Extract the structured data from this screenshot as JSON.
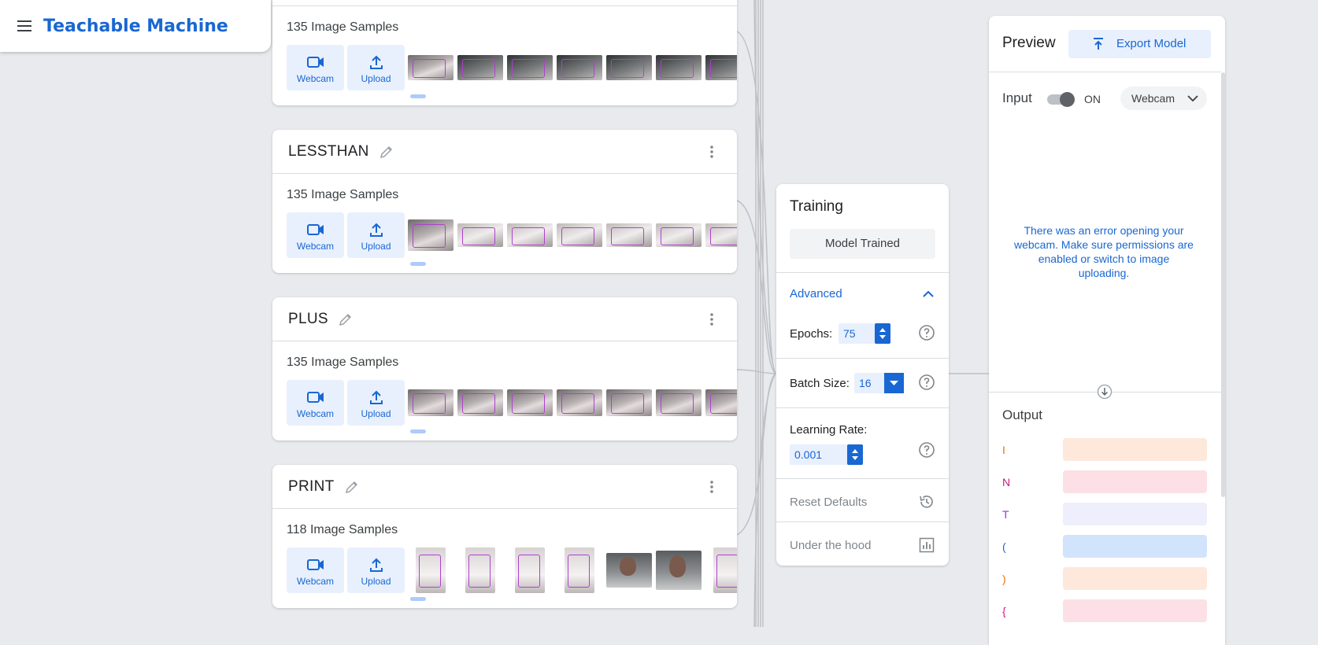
{
  "header": {
    "title": "Teachable Machine"
  },
  "classes": [
    {
      "name": "",
      "sample_count": "135 Image Samples",
      "webcam_label": "Webcam",
      "upload_label": "Upload"
    },
    {
      "name": "LESSTHAN",
      "sample_count": "135 Image Samples",
      "webcam_label": "Webcam",
      "upload_label": "Upload"
    },
    {
      "name": "PLUS",
      "sample_count": "135 Image Samples",
      "webcam_label": "Webcam",
      "upload_label": "Upload"
    },
    {
      "name": "PRINT",
      "sample_count": "118 Image Samples",
      "webcam_label": "Webcam",
      "upload_label": "Upload"
    }
  ],
  "training": {
    "title": "Training",
    "trained_label": "Model Trained",
    "advanced_label": "Advanced",
    "epochs_label": "Epochs:",
    "epochs_value": "75",
    "batch_label": "Batch Size:",
    "batch_value": "16",
    "lr_label": "Learning Rate:",
    "lr_value": "0.001",
    "reset_label": "Reset Defaults",
    "hood_label": "Under the hood"
  },
  "preview": {
    "title": "Preview",
    "export_label": "Export Model",
    "input_label": "Input",
    "toggle_state": "ON",
    "source_label": "Webcam",
    "error_message": "There was an error opening your webcam. Make sure permissions are enabled or switch to image uploading.",
    "output_label": "Output",
    "outputs": [
      {
        "label": "I",
        "color": "#e8710a",
        "bar_color": "#fde8db"
      },
      {
        "label": "N",
        "color": "#d01884",
        "bar_color": "#fce0e6"
      },
      {
        "label": "T",
        "color": "#9334e6",
        "bar_color": "#eeeefc"
      },
      {
        "label": "(",
        "color": "#1967d2",
        "bar_color": "#d2e3fc"
      },
      {
        "label": ")",
        "color": "#e8710a",
        "bar_color": "#fde8db"
      },
      {
        "label": "{",
        "color": "#d01884",
        "bar_color": "#fce0e6"
      }
    ]
  },
  "colors": {
    "accent": "#1967d2",
    "background": "#e8eaed"
  }
}
